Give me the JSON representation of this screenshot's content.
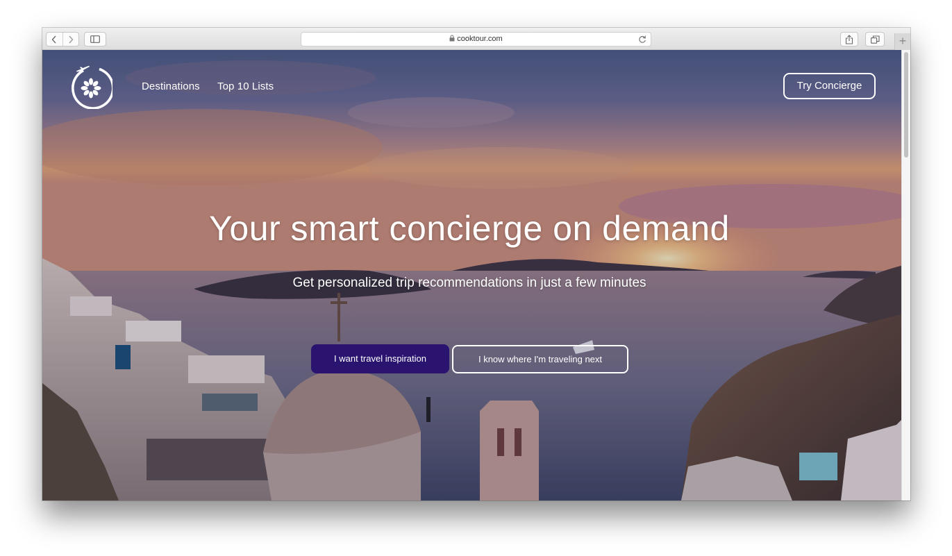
{
  "browser": {
    "url": "cooktour.com",
    "new_tab_label": "+"
  },
  "site": {
    "nav": {
      "destinations": "Destinations",
      "top10": "Top 10 Lists",
      "try_concierge": "Try Concierge"
    },
    "hero": {
      "headline": "Your smart concierge on demand",
      "subheadline": "Get personalized trip recommendations in just a few minutes",
      "primary_button": "I want travel inspiration",
      "secondary_button": "I know where I'm traveling next"
    }
  },
  "colors": {
    "primary_button_bg": "#2a1470",
    "text_on_hero": "#ffffff"
  },
  "icons": {
    "back": "chevron-left-icon",
    "forward": "chevron-right-icon",
    "sidebar": "sidebar-icon",
    "lock": "lock-icon",
    "reload": "reload-icon",
    "share": "share-icon",
    "tabs": "tabs-icon",
    "logo": "plane-flower-logo"
  }
}
